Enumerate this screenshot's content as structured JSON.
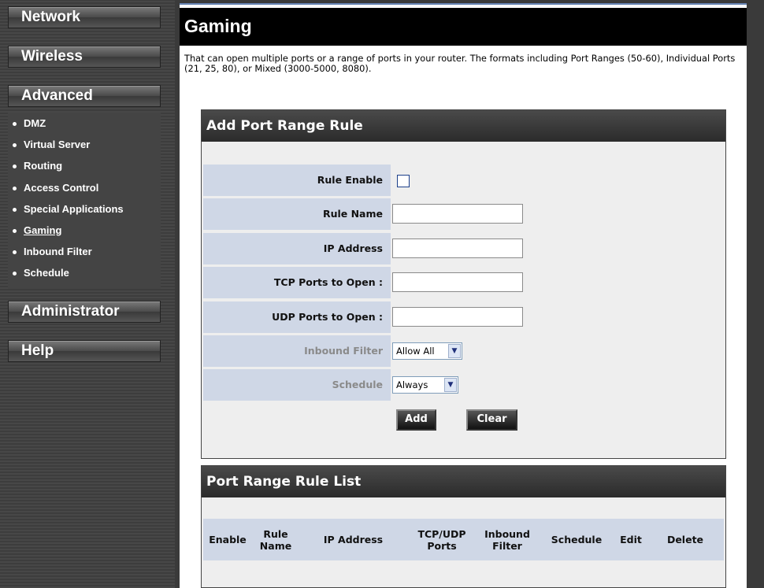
{
  "sidebar": {
    "menu": [
      {
        "label": "Network"
      },
      {
        "label": "Wireless"
      },
      {
        "label": "Advanced"
      },
      {
        "label": "Administrator"
      },
      {
        "label": "Help"
      }
    ],
    "advanced_items": [
      {
        "label": "DMZ"
      },
      {
        "label": "Virtual Server"
      },
      {
        "label": "Routing"
      },
      {
        "label": "Access Control"
      },
      {
        "label": "Special Applications"
      },
      {
        "label": "Gaming"
      },
      {
        "label": "Inbound Filter"
      },
      {
        "label": "Schedule"
      }
    ]
  },
  "page": {
    "title": "Gaming",
    "intro": "That can open multiple ports or a range of ports in your router. The formats including Port Ranges (50-60), Individual Ports (21, 25, 80), or Mixed (3000-5000, 8080)."
  },
  "add_rule": {
    "title": "Add Port Range Rule",
    "labels": {
      "rule_enable": "Rule Enable",
      "rule_name": "Rule Name",
      "ip_address": "IP Address",
      "tcp_ports": "TCP Ports to Open :",
      "udp_ports": "UDP Ports to Open :",
      "inbound_filter": "Inbound Filter",
      "schedule": "Schedule"
    },
    "values": {
      "rule_enable": false,
      "rule_name": "",
      "ip_address": "",
      "tcp_ports": "",
      "udp_ports": "",
      "inbound_filter": "Allow All",
      "schedule": "Always"
    },
    "buttons": {
      "add": "Add",
      "clear": "Clear"
    }
  },
  "rule_list": {
    "title": "Port Range Rule List",
    "columns": [
      "Enable",
      "Rule Name",
      "IP Address",
      "TCP/UDP Ports",
      "Inbound Filter",
      "Schedule",
      "Edit",
      "Delete"
    ],
    "rows": []
  },
  "colors": {
    "label_bg": "#cfd7e6",
    "panel_bg": "#eeeeee",
    "header_bg": "#000000"
  }
}
